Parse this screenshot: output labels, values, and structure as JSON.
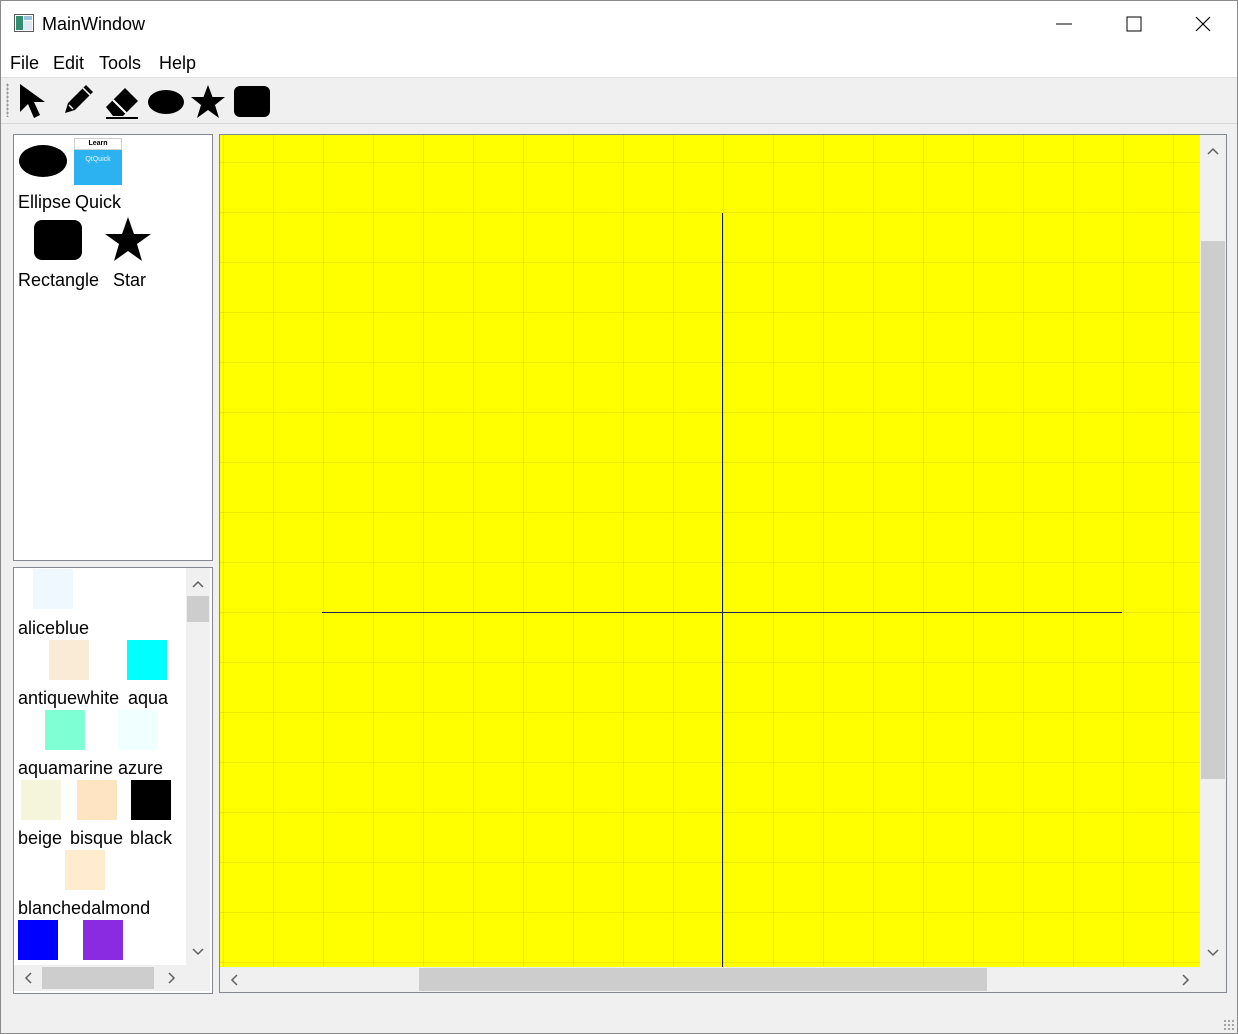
{
  "window": {
    "title": "MainWindow",
    "icons": {
      "app": "app-window-icon",
      "minimize": "minimize-icon",
      "maximize": "maximize-icon",
      "close": "close-icon"
    }
  },
  "menu": [
    {
      "label": "File"
    },
    {
      "label": "Edit"
    },
    {
      "label": "Tools"
    },
    {
      "label": "Help"
    }
  ],
  "toolbar": {
    "tools": [
      {
        "name": "pointer",
        "icon": "arrow-pointer-icon"
      },
      {
        "name": "pencil",
        "icon": "pencil-icon"
      },
      {
        "name": "eraser",
        "icon": "eraser-icon"
      },
      {
        "name": "ellipse",
        "icon": "ellipse-icon"
      },
      {
        "name": "star",
        "icon": "star-icon"
      },
      {
        "name": "rectangle",
        "icon": "rounded-rectangle-icon"
      }
    ]
  },
  "shapes": [
    {
      "label": "Ellipse",
      "icon": "ellipse-icon"
    },
    {
      "label": "Quick",
      "icon": "learn-qtquick-thumbnail",
      "thumb_title": "Learn",
      "thumb_text": "QtQuick"
    },
    {
      "label": "Rectangle",
      "icon": "rounded-rectangle-icon"
    },
    {
      "label": "Star",
      "icon": "star-icon"
    }
  ],
  "colors": [
    {
      "label": "aliceblue",
      "hex": "#f0f8ff"
    },
    {
      "label": "antiquewhite",
      "hex": "#faebd7"
    },
    {
      "label": "aqua",
      "hex": "#00ffff"
    },
    {
      "label": "aquamarine",
      "hex": "#7fffd4"
    },
    {
      "label": "azure",
      "hex": "#f0ffff"
    },
    {
      "label": "beige",
      "hex": "#f5f5dc"
    },
    {
      "label": "bisque",
      "hex": "#ffe4c4"
    },
    {
      "label": "black",
      "hex": "#000000"
    },
    {
      "label": "blanchedalmond",
      "hex": "#ffebcd"
    },
    {
      "label": "",
      "hex": "#0000ff"
    },
    {
      "label": "",
      "hex": "#8a2be2"
    }
  ],
  "canvas": {
    "background": "#ffff00",
    "grid": true,
    "axis_color": "#202060"
  },
  "colors_theme": {
    "window_bg": "#f0f0f0",
    "scroll_thumb": "#cdcdcd"
  }
}
